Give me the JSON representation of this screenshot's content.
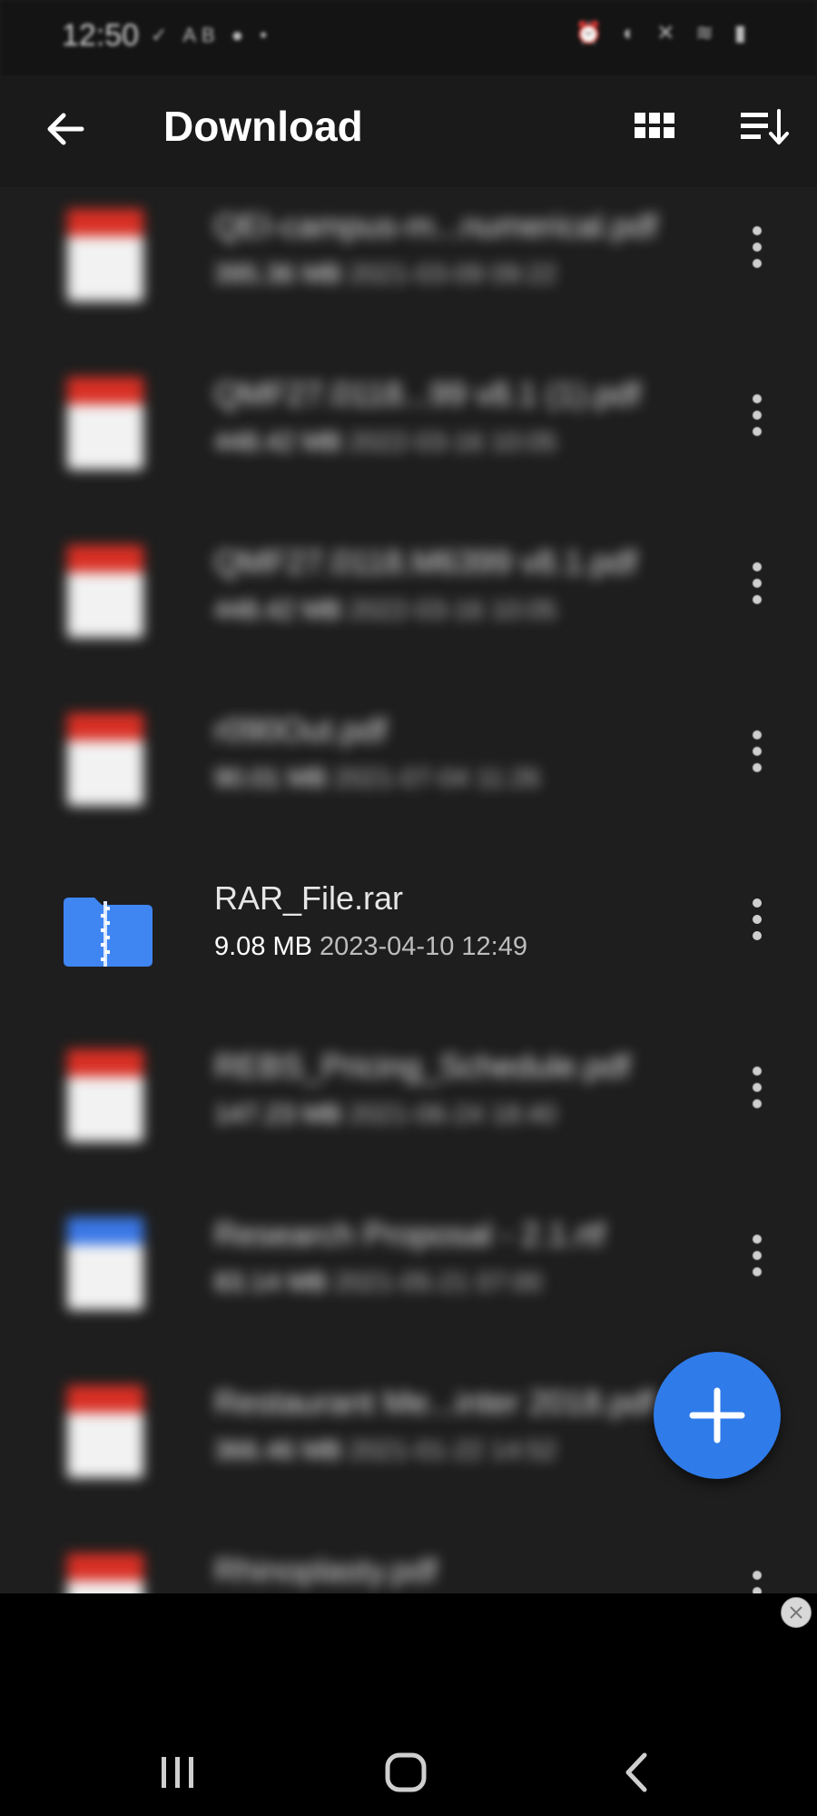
{
  "status_bar": {
    "time": "12:50",
    "left_icons": "✓ AB ● •",
    "right_icons": "⏰ ◐ ✕ ≋ ▮"
  },
  "app_bar": {
    "title": "Download",
    "back_icon": "arrow-left-icon",
    "grid_icon": "grid-view-icon",
    "sort_icon": "sort-icon"
  },
  "files": [
    {
      "name": "QEI-campus-m...numerical.pdf",
      "size": "395.36 MB",
      "date": "2021-03-09 09:22",
      "type": "pdf"
    },
    {
      "name": "QMF27.0118...99 v8.1 (1).pdf",
      "size": "448.42 MB",
      "date": "2022-03-16 10:05",
      "type": "pdf"
    },
    {
      "name": "QMF27.0118.M6399 v8.1.pdf",
      "size": "448.42 MB",
      "date": "2022-03-16 10:05",
      "type": "pdf"
    },
    {
      "name": "r090Out.pdf",
      "size": "90.01 MB",
      "date": "2021-07-04 11:26",
      "type": "pdf"
    },
    {
      "name": "RAR_File.rar",
      "size": "9.08 MB",
      "date": "2023-04-10 12:49",
      "type": "rar"
    },
    {
      "name": "REBS_Pricing_Schedule.pdf",
      "size": "147.23 MB",
      "date": "2021-06-24 18:40",
      "type": "pdf"
    },
    {
      "name": "Research Proposal - 2.1.rtf",
      "size": "83.14 MB",
      "date": "2021-05-21 07:00",
      "type": "doc"
    },
    {
      "name": "Restaurant Me...inter 2018.pdf",
      "size": "366.46 MB",
      "date": "2021-01-22 14:52",
      "type": "pdf"
    },
    {
      "name": "Rhinoplasty.pdf",
      "size": "",
      "date": "",
      "type": "pdf"
    }
  ],
  "fab": {
    "icon": "plus-icon"
  },
  "colors": {
    "accent": "#2f7bea",
    "pdf_red": "#d93025",
    "doc_blue": "#3b78e7",
    "background": "#1e1e1e"
  },
  "nav_bar": {
    "recents_icon": "recents-icon",
    "home_icon": "home-icon",
    "back_icon": "nav-back-icon"
  }
}
